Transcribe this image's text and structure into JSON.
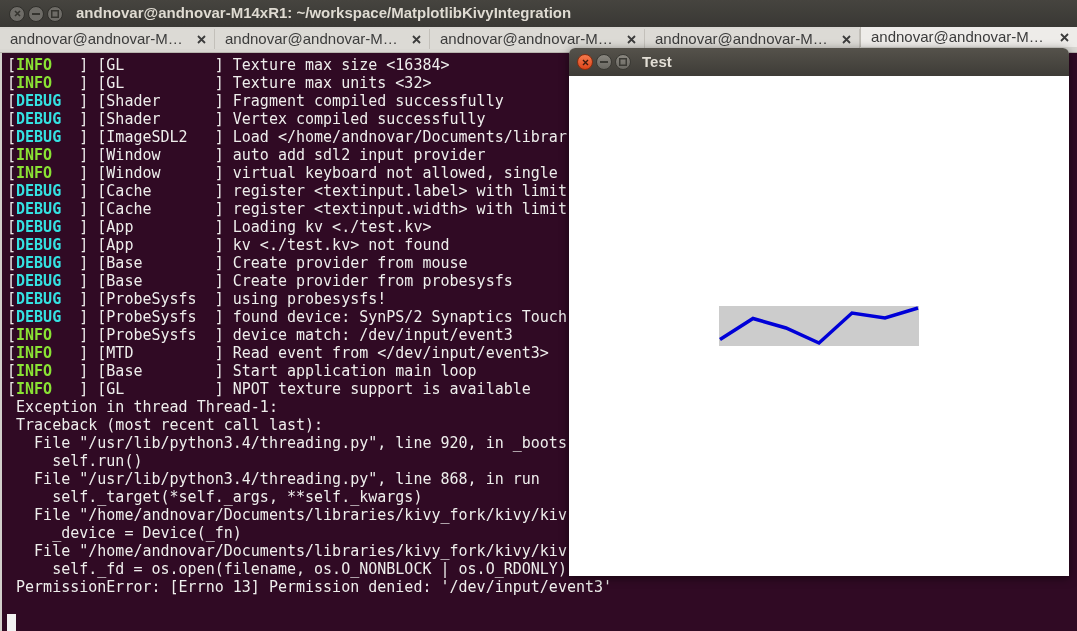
{
  "window": {
    "title": "andnovar@andnovar-M14xR1: ~/workspace/MatplotlibKivyIntegration"
  },
  "tabs": [
    {
      "label": "andnovar@andnovar-M…",
      "selected": false
    },
    {
      "label": "andnovar@andnovar-M…",
      "selected": false
    },
    {
      "label": "andnovar@andnovar-M…",
      "selected": false
    },
    {
      "label": "andnovar@andnovar-M…",
      "selected": false
    },
    {
      "label": "andnovar@andnovar-M…",
      "selected": true
    }
  ],
  "terminal": {
    "lines": [
      {
        "kind": "info",
        "open": "[",
        "tag": "INFO",
        "rest": "   ] [GL          ] Texture max size <16384>"
      },
      {
        "kind": "info",
        "open": "[",
        "tag": "INFO",
        "rest": "   ] [GL          ] Texture max units <32>"
      },
      {
        "kind": "debug",
        "open": "[",
        "tag": "DEBUG",
        "rest": "  ] [Shader      ] Fragment compiled successfully"
      },
      {
        "kind": "debug",
        "open": "[",
        "tag": "DEBUG",
        "rest": "  ] [Shader      ] Vertex compiled successfully"
      },
      {
        "kind": "debug",
        "open": "[",
        "tag": "DEBUG",
        "rest": "  ] [ImageSDL2   ] Load </home/andnovar/Documents/librar"
      },
      {
        "kind": "info",
        "open": "[",
        "tag": "INFO",
        "rest": "   ] [Window      ] auto add sdl2 input provider"
      },
      {
        "kind": "info",
        "open": "[",
        "tag": "INFO",
        "rest": "   ] [Window      ] virtual keyboard not allowed, single"
      },
      {
        "kind": "debug",
        "open": "[",
        "tag": "DEBUG",
        "rest": "  ] [Cache       ] register <textinput.label> with limit"
      },
      {
        "kind": "debug",
        "open": "[",
        "tag": "DEBUG",
        "rest": "  ] [Cache       ] register <textinput.width> with limit"
      },
      {
        "kind": "debug",
        "open": "[",
        "tag": "DEBUG",
        "rest": "  ] [App         ] Loading kv <./test.kv>"
      },
      {
        "kind": "debug",
        "open": "[",
        "tag": "DEBUG",
        "rest": "  ] [App         ] kv <./test.kv> not found"
      },
      {
        "kind": "debug",
        "open": "[",
        "tag": "DEBUG",
        "rest": "  ] [Base        ] Create provider from mouse"
      },
      {
        "kind": "debug",
        "open": "[",
        "tag": "DEBUG",
        "rest": "  ] [Base        ] Create provider from probesysfs"
      },
      {
        "kind": "debug",
        "open": "[",
        "tag": "DEBUG",
        "rest": "  ] [ProbeSysfs  ] using probesysfs!"
      },
      {
        "kind": "debug",
        "open": "[",
        "tag": "DEBUG",
        "rest": "  ] [ProbeSysfs  ] found device: SynPS/2 Synaptics Touch"
      },
      {
        "kind": "info",
        "open": "[",
        "tag": "INFO",
        "rest": "   ] [ProbeSysfs  ] device match: /dev/input/event3"
      },
      {
        "kind": "info",
        "open": "[",
        "tag": "INFO",
        "rest": "   ] [MTD         ] Read event from </dev/input/event3>"
      },
      {
        "kind": "info",
        "open": "[",
        "tag": "INFO",
        "rest": "   ] [Base        ] Start application main loop"
      },
      {
        "kind": "info",
        "open": "[",
        "tag": "INFO",
        "rest": "   ] [GL          ] NPOT texture support is available"
      },
      {
        "kind": "plain",
        "text": " Exception in thread Thread-1:"
      },
      {
        "kind": "plain",
        "text": " Traceback (most recent call last):"
      },
      {
        "kind": "plain",
        "text": "   File \"/usr/lib/python3.4/threading.py\", line 920, in _boots"
      },
      {
        "kind": "plain",
        "text": "     self.run()"
      },
      {
        "kind": "plain",
        "text": "   File \"/usr/lib/python3.4/threading.py\", line 868, in run"
      },
      {
        "kind": "plain",
        "text": "     self._target(*self._args, **self._kwargs)"
      },
      {
        "kind": "plain",
        "text": "   File \"/home/andnovar/Documents/libraries/kivy_fork/kivy/kiv"
      },
      {
        "kind": "plain",
        "text": "     _device = Device(_fn)"
      },
      {
        "kind": "plain",
        "text": "   File \"/home/andnovar/Documents/libraries/kivy_fork/kivy/kiv"
      },
      {
        "kind": "plain",
        "text": "     self._fd = os.open(filename, os.O_NONBLOCK | os.O_RDONLY)"
      },
      {
        "kind": "plain",
        "text": " PermissionError: [Errno 13] Permission denied: '/dev/input/event3'"
      }
    ]
  },
  "app_window": {
    "title": "Test"
  }
}
